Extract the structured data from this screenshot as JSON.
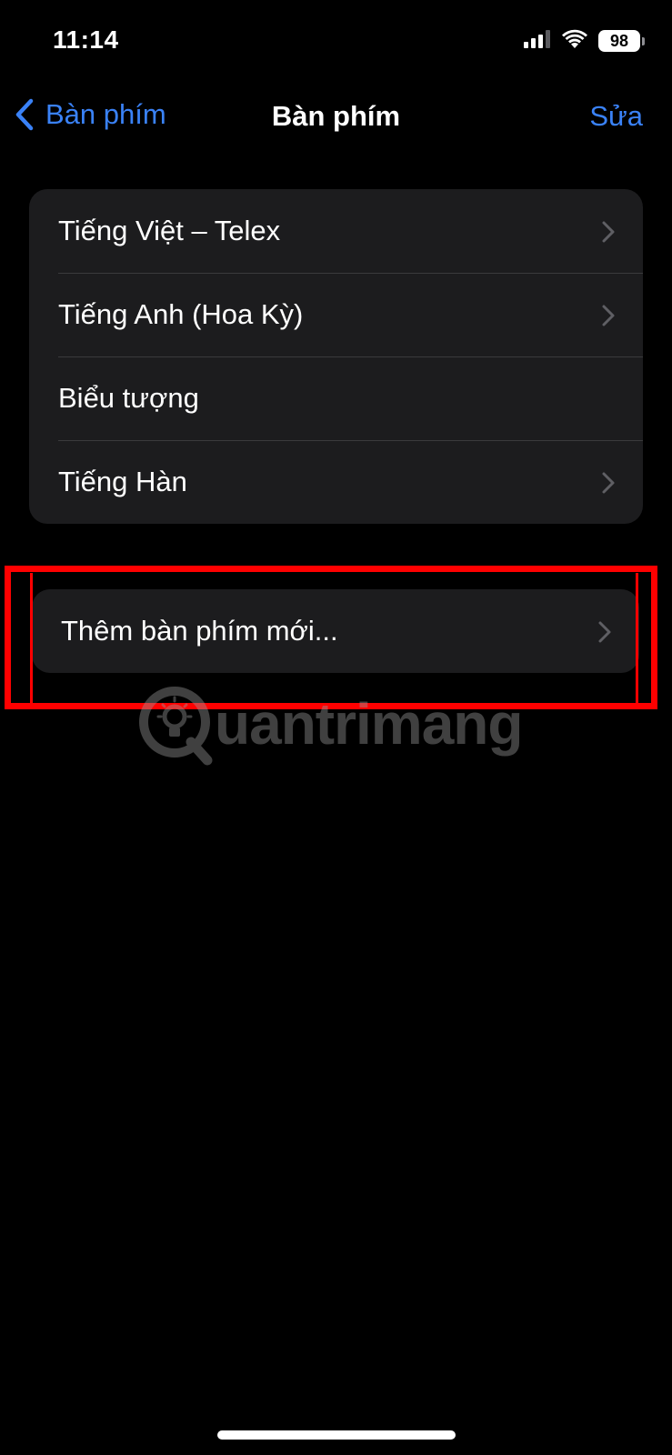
{
  "status_bar": {
    "time": "11:14",
    "battery_level": "98",
    "icons": [
      "cellular-signal-icon",
      "wifi-icon",
      "battery-icon"
    ]
  },
  "nav": {
    "back_label": "Bàn phím",
    "title": "Bàn phím",
    "edit_label": "Sửa"
  },
  "keyboards": [
    {
      "label": "Tiếng Việt – Telex",
      "chevron": true
    },
    {
      "label": "Tiếng Anh (Hoa Kỳ)",
      "chevron": true
    },
    {
      "label": "Biểu tượng",
      "chevron": false
    },
    {
      "label": "Tiếng Hàn",
      "chevron": true
    }
  ],
  "add_keyboard": {
    "label": "Thêm bàn phím mới..."
  },
  "watermark": {
    "text": "uantrimang"
  },
  "colors": {
    "background": "#000000",
    "cell": "#1c1c1e",
    "accent": "#3a82f7",
    "highlight": "#ff0000",
    "separator": "#3a3a3c"
  }
}
